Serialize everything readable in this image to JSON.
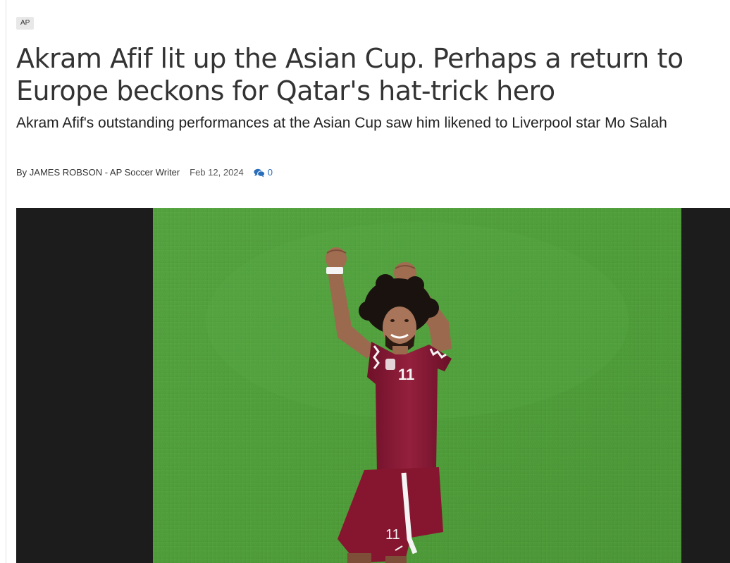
{
  "article": {
    "source_tag": "AP",
    "headline": "Akram Afif lit up the Asian Cup. Perhaps a return to Europe beckons for Qatar's hat-trick hero",
    "subheadline": "Akram Afif's outstanding performances at the Asian Cup saw him likened to Liverpool star Mo Salah",
    "byline": "By JAMES ROBSON - AP Soccer Writer",
    "date": "Feb 12, 2024",
    "comment_count": "0",
    "comment_icon": "comments-icon",
    "photo": {
      "jersey_number": "11",
      "alt": "Qatar player celebrating with both fists raised on a soccer pitch"
    }
  },
  "colors": {
    "headline": "#333333",
    "link_blue": "#2a6ebb",
    "tag_bg": "#e8e8e8",
    "frame_bg": "#1c1c1c",
    "pitch_green": "#4f9d3a",
    "jersey_maroon": "#8a1a36"
  }
}
